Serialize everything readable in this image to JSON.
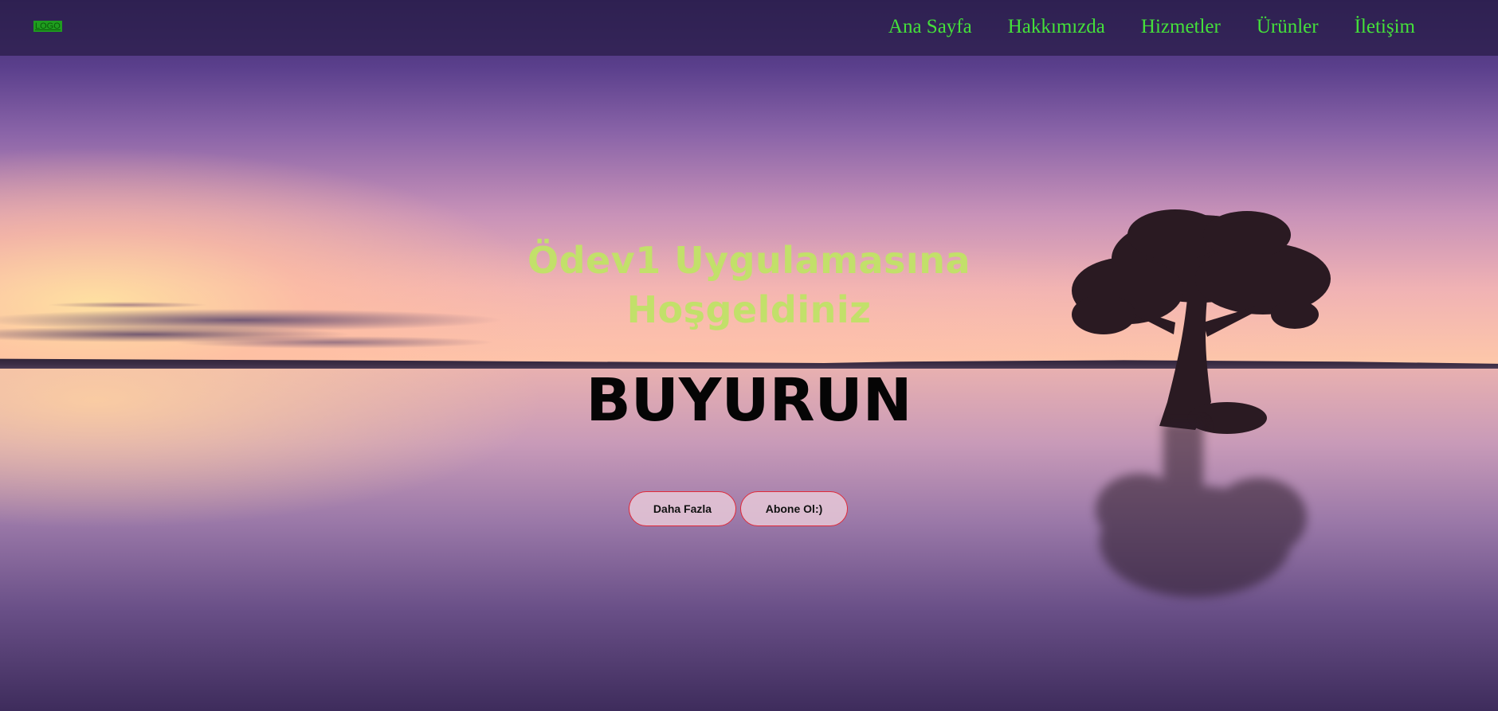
{
  "header": {
    "logo_text": "LOGO",
    "nav_items": [
      {
        "label": "Ana Sayfa"
      },
      {
        "label": "Hakkımızda"
      },
      {
        "label": "Hizmetler"
      },
      {
        "label": "Ürünler"
      },
      {
        "label": "İletişim"
      }
    ]
  },
  "hero": {
    "title": "Ödev1 Uygulamasına Hoşgeldiniz",
    "subtitle": "BUYURUN",
    "buttons": {
      "more_label": "Daha Fazla",
      "subscribe_label": "Abone Ol:)"
    }
  },
  "colors": {
    "nav_text": "#44e03a",
    "title_text": "#c2e06a",
    "button_border": "#e02a3a",
    "navbar_bg": "#281c46"
  }
}
